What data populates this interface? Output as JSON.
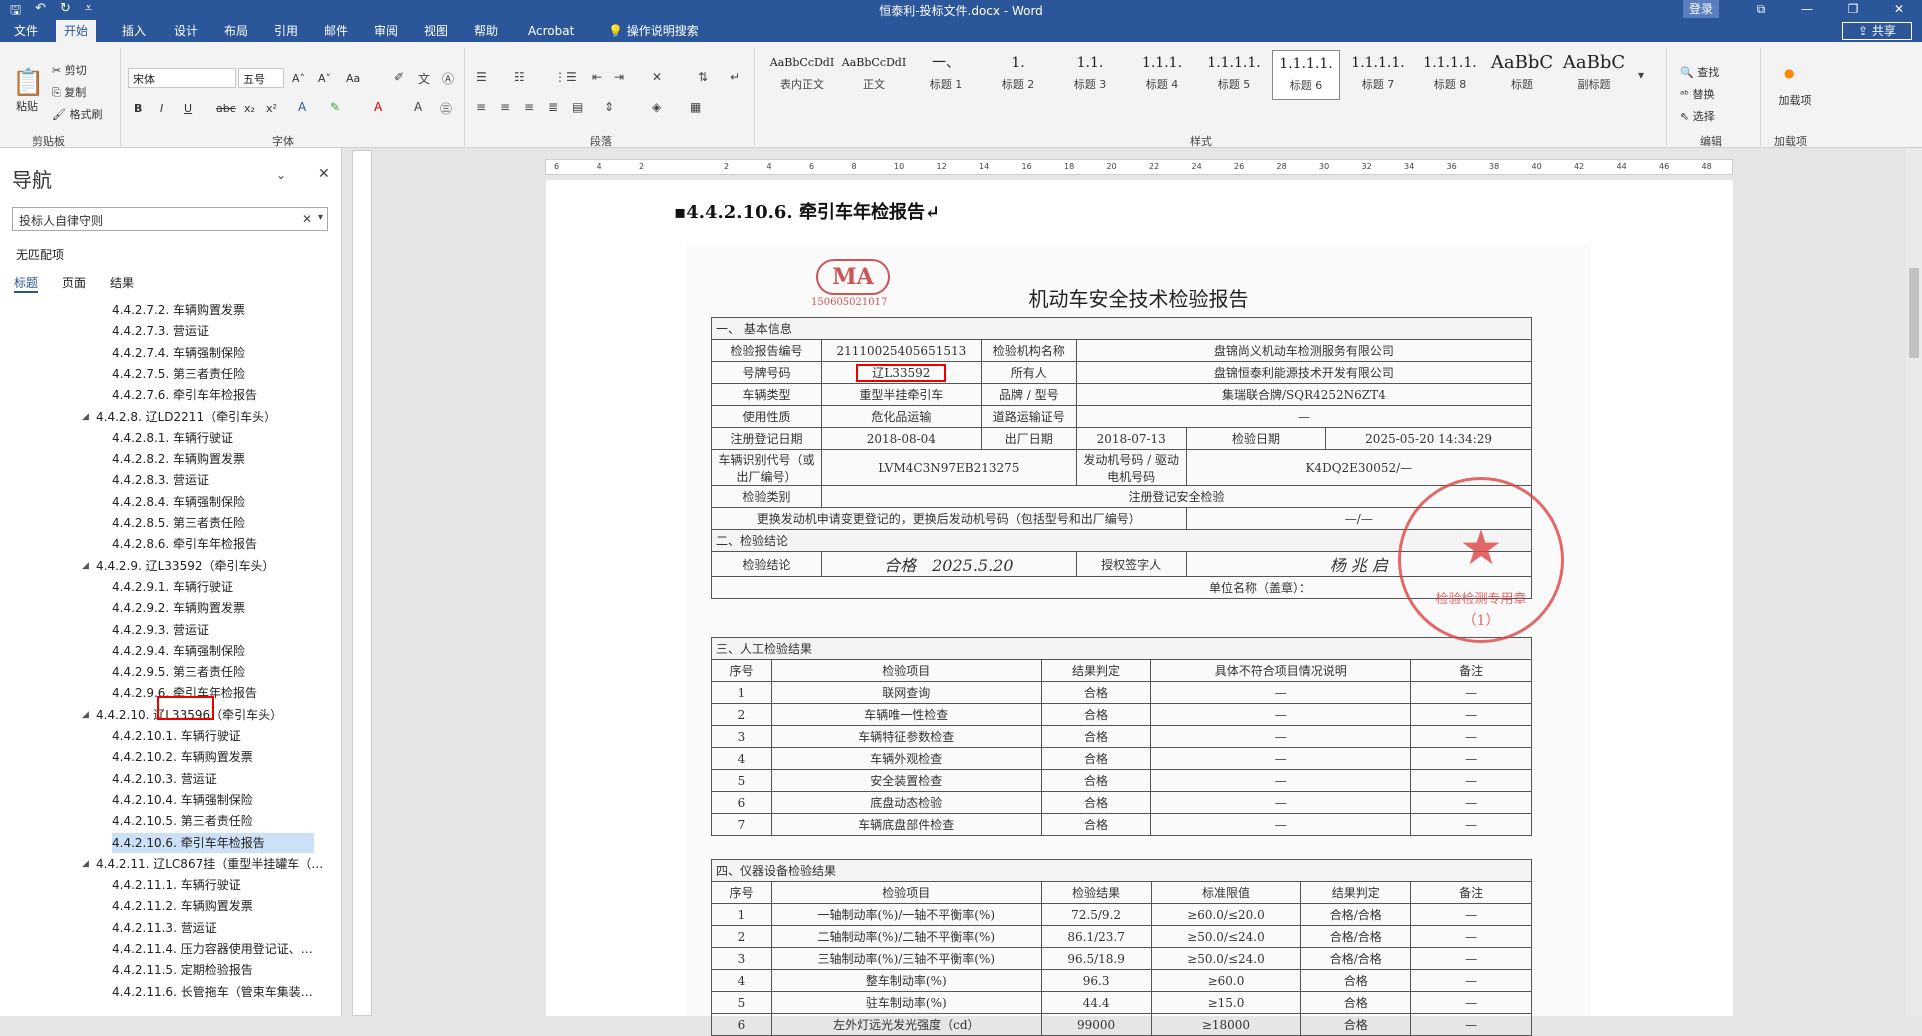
{
  "window": {
    "title": "恒泰利-投标文件.docx - Word",
    "sign_in": "登录"
  },
  "quick_access": {
    "save": "🖫",
    "undo": "↶",
    "redo": "↻",
    "customize": "⩡"
  },
  "tabs": [
    "文件",
    "开始",
    "插入",
    "设计",
    "布局",
    "引用",
    "邮件",
    "审阅",
    "视图",
    "帮助",
    "Acrobat",
    "操作说明搜索"
  ],
  "share_label": "共享",
  "ribbon": {
    "clipboard": {
      "paste": "粘贴",
      "cut": "剪切",
      "copy": "复制",
      "format_painter": "格式刷",
      "group": "剪贴板"
    },
    "font": {
      "name": "宋体",
      "size": "五号",
      "group": "字体",
      "grow": "A˄",
      "shrink": "A˅",
      "case": "Aa",
      "bold": "B",
      "italic": "I",
      "underline": "U",
      "strike": "abc",
      "sub": "x₂",
      "sup": "x²"
    },
    "paragraph": {
      "group": "段落"
    },
    "styles": {
      "items": [
        {
          "preview": "AaBbCcDdI",
          "name": "表内正文"
        },
        {
          "preview": "AaBbCcDdI",
          "name": "正文"
        },
        {
          "preview": "一、",
          "name": "标题 1"
        },
        {
          "preview": "1.",
          "name": "标题 2"
        },
        {
          "preview": "1.1.",
          "name": "标题 3"
        },
        {
          "preview": "1.1.1.",
          "name": "标题 4"
        },
        {
          "preview": "1.1.1.1.",
          "name": "标题 5"
        },
        {
          "preview": "1.1.1.1.",
          "name": "标题 6"
        },
        {
          "preview": "1.1.1.1.",
          "name": "标题 7"
        },
        {
          "preview": "1.1.1.1.",
          "name": "标题 8"
        },
        {
          "preview": "AaBbC",
          "name": "标题"
        },
        {
          "preview": "AaBbC",
          "name": "副标题"
        }
      ],
      "group": "样式"
    },
    "editing": {
      "find": "查找",
      "replace": "替换",
      "select": "选择",
      "group": "编辑"
    },
    "addins": {
      "label": "加载项",
      "group": "加载项"
    }
  },
  "nav": {
    "title": "导航",
    "search": "投标人自律守则",
    "no_match": "无匹配项",
    "tabs": [
      "标题",
      "页面",
      "结果"
    ],
    "items": [
      {
        "text": "4.4.2.7.2. 车辆购置发票",
        "level": 3
      },
      {
        "text": "4.4.2.7.3. 营运证",
        "level": 3
      },
      {
        "text": "4.4.2.7.4. 车辆强制保险",
        "level": 3
      },
      {
        "text": "4.4.2.7.5. 第三者责任险",
        "level": 3
      },
      {
        "text": "4.4.2.7.6. 牵引车年检报告",
        "level": 3
      },
      {
        "text": "4.4.2.8. 辽LD2211（牵引车头）",
        "level": 2
      },
      {
        "text": "4.4.2.8.1. 车辆行驶证",
        "level": 3
      },
      {
        "text": "4.4.2.8.2. 车辆购置发票",
        "level": 3
      },
      {
        "text": "4.4.2.8.3. 营运证",
        "level": 3
      },
      {
        "text": "4.4.2.8.4. 车辆强制保险",
        "level": 3
      },
      {
        "text": "4.4.2.8.5. 第三者责任险",
        "level": 3
      },
      {
        "text": "4.4.2.8.6. 牵引车年检报告",
        "level": 3
      },
      {
        "text": "4.4.2.9. 辽L33592（牵引车头）",
        "level": 2
      },
      {
        "text": "4.4.2.9.1. 车辆行驶证",
        "level": 3
      },
      {
        "text": "4.4.2.9.2. 车辆购置发票",
        "level": 3
      },
      {
        "text": "4.4.2.9.3. 营运证",
        "level": 3
      },
      {
        "text": "4.4.2.9.4. 车辆强制保险",
        "level": 3
      },
      {
        "text": "4.4.2.9.5. 第三者责任险",
        "level": 3
      },
      {
        "text": "4.4.2.9.6. 牵引车年检报告",
        "level": 3
      },
      {
        "text": "4.4.2.10. 辽L33596（牵引车头）",
        "level": 2
      },
      {
        "text": "4.4.2.10.1. 车辆行驶证",
        "level": 3
      },
      {
        "text": "4.4.2.10.2. 车辆购置发票",
        "level": 3
      },
      {
        "text": "4.4.2.10.3. 营运证",
        "level": 3
      },
      {
        "text": "4.4.2.10.4. 车辆强制保险",
        "level": 3
      },
      {
        "text": "4.4.2.10.5. 第三者责任险",
        "level": 3
      },
      {
        "text": "4.4.2.10.6. 牵引车年检报告",
        "level": 3,
        "selected": true
      },
      {
        "text": "4.4.2.11. 辽LC867挂（重型半挂罐车（…",
        "level": 2
      },
      {
        "text": "4.4.2.11.1. 车辆行驶证",
        "level": 3
      },
      {
        "text": "4.4.2.11.2. 车辆购置发票",
        "level": 3
      },
      {
        "text": "4.4.2.11.3. 营运证",
        "level": 3
      },
      {
        "text": "4.4.2.11.4. 压力容器使用登记证、…",
        "level": 3
      },
      {
        "text": "4.4.2.11.5. 定期检验报告",
        "level": 3
      },
      {
        "text": "4.4.2.11.6. 长管拖车（管束车集装…",
        "level": 3
      }
    ]
  },
  "ruler_ticks": [
    "6",
    "4",
    "2",
    "",
    "2",
    "4",
    "6",
    "8",
    "10",
    "12",
    "14",
    "16",
    "18",
    "20",
    "22",
    "24",
    "26",
    "28",
    "30",
    "32",
    "34",
    "36",
    "38",
    "40",
    "42",
    "44",
    "46",
    "48"
  ],
  "doc": {
    "heading": "▪4.4.2.10.6. 牵引车年检报告↵",
    "report": {
      "ma_logo": "MA",
      "ma_code": "150605021017",
      "title": "机动车安全技术检验报告",
      "sec1": "一、 基本信息",
      "report_no_label": "检验报告编号",
      "report_no": "21110025405651513",
      "agency_label": "检验机构名称",
      "agency": "盘锦尚义机动车检测服务有限公司",
      "plate_label": "号牌号码",
      "plate": "辽L33592",
      "owner_label": "所有人",
      "owner": "盘锦恒泰利能源技术开发有限公司",
      "type_label": "车辆类型",
      "type": "重型半挂牵引车",
      "brand_label": "品牌 / 型号",
      "brand": "集瑞联合牌/SQR4252N6ZT4",
      "use_label": "使用性质",
      "use": "危化品运输",
      "permit_label": "道路运输证号",
      "permit": "—",
      "reg_label": "注册登记日期",
      "reg": "2018-08-04",
      "mfg_label": "出厂日期",
      "mfg": "2018-07-13",
      "insp_label": "检验日期",
      "insp": "2025-05-20 14:34:29",
      "vin_label": "车辆识别代号（或出厂编号）",
      "vin": "LVM4C3N97EB213275",
      "engine_label": "发动机号码 / 驱动电机号码",
      "engine": "K4DQ2E30052/—",
      "cat_label": "检验类别",
      "cat": "注册登记安全检验",
      "change_note": "更换发动机申请变更登记的，更换后发动机号码（包括型号和出厂编号）",
      "change_val": "—/—",
      "sec2": "二、检验结论",
      "concl_label": "检验结论",
      "concl": "合格　2025.5.20",
      "signer_label": "授权签字人",
      "signer": "杨 兆 启",
      "unit_label": "单位名称（盖章）：",
      "sec3": "三、人工检验结果",
      "manual_head": [
        "序号",
        "检验项目",
        "结果判定",
        "具体不符合项目情况说明",
        "备注"
      ],
      "manual_rows": [
        [
          "1",
          "联网查询",
          "合格",
          "—",
          "—"
        ],
        [
          "2",
          "车辆唯一性检查",
          "合格",
          "—",
          "—"
        ],
        [
          "3",
          "车辆特征参数检查",
          "合格",
          "—",
          "—"
        ],
        [
          "4",
          "车辆外观检查",
          "合格",
          "—",
          "—"
        ],
        [
          "5",
          "安全装置检查",
          "合格",
          "—",
          "—"
        ],
        [
          "6",
          "底盘动态检验",
          "合格",
          "—",
          "—"
        ],
        [
          "7",
          "车辆底盘部件检查",
          "合格",
          "—",
          "—"
        ]
      ],
      "sec4": "四、仪器设备检验结果",
      "inst_head": [
        "序号",
        "检验项目",
        "检验结果",
        "标准限值",
        "结果判定",
        "备注"
      ],
      "inst_rows": [
        [
          "1",
          "一轴制动率(%)/一轴不平衡率(%)",
          "72.5/9.2",
          "≥60.0/≤20.0",
          "合格/合格",
          "—"
        ],
        [
          "2",
          "二轴制动率(%)/二轴不平衡率(%)",
          "86.1/23.7",
          "≥50.0/≤24.0",
          "合格/合格",
          "—"
        ],
        [
          "3",
          "三轴制动率(%)/三轴不平衡率(%)",
          "96.5/18.9",
          "≥50.0/≤24.0",
          "合格/合格",
          "—"
        ],
        [
          "4",
          "整车制动率(%)",
          "96.3",
          "≥60.0",
          "合格",
          "—"
        ],
        [
          "5",
          "驻车制动率(%)",
          "44.4",
          "≥15.0",
          "合格",
          "—"
        ],
        [
          "6",
          "左外灯远光发光强度（cd）",
          "99000",
          "≥18000",
          "合格",
          "—"
        ]
      ],
      "seal_text": "检验检测专用章",
      "seal_num": "（1）"
    }
  }
}
